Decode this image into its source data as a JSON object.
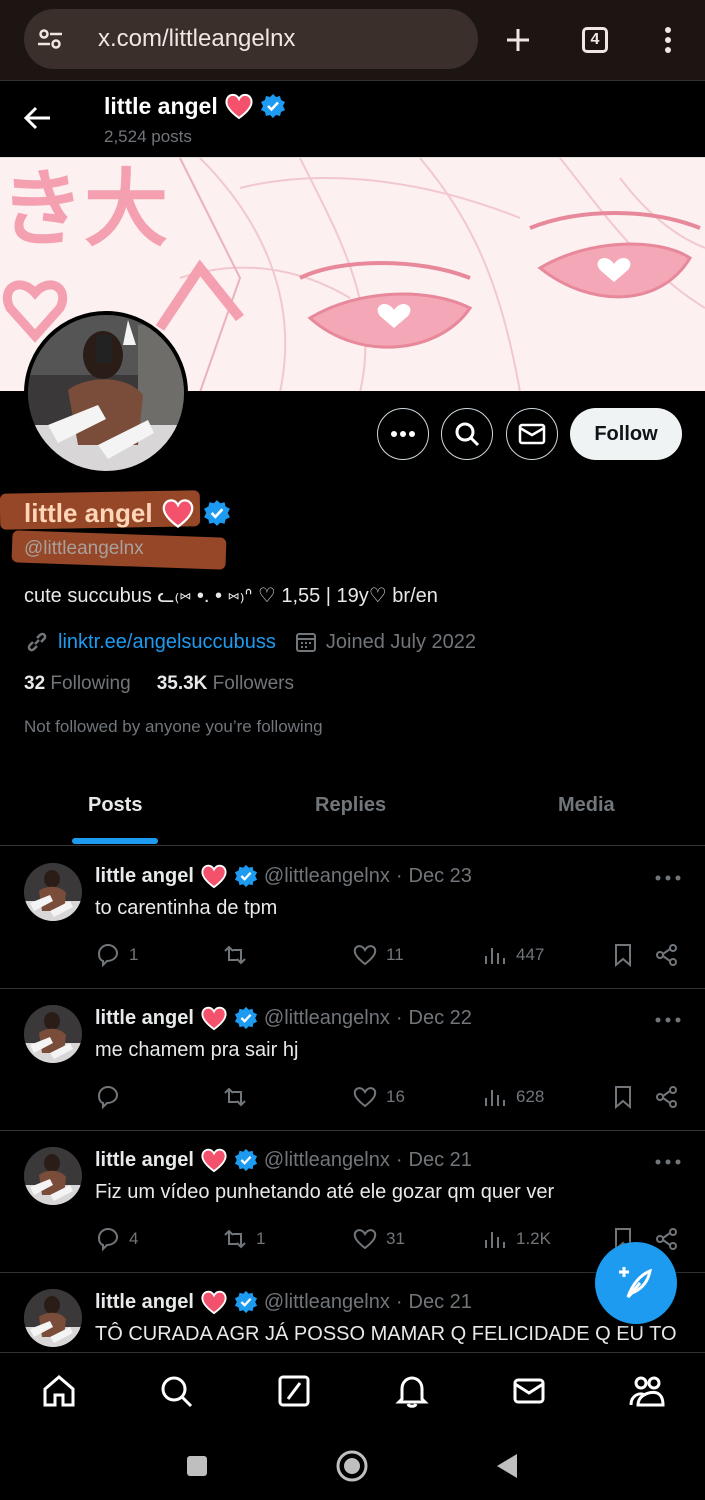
{
  "browser": {
    "url": "x.com/littleangelnx",
    "tab_count": "4",
    "icons": [
      "site-settings-icon",
      "new-tab-icon",
      "tab-switcher-icon",
      "kebab-menu-icon"
    ]
  },
  "header": {
    "name": "little angel",
    "posts_count": "2,524 posts"
  },
  "profile": {
    "name": "little angel",
    "handle": "@littleangelnx",
    "bio": "cute succubus ᓚ₍⑅ •. • ⑅₎ᐢ ♡ 1,55 | 19y♡ br/en",
    "link": "linktr.ee/angelsuccubuss",
    "joined": "Joined July 2022",
    "following_count": "32",
    "following_label": "Following",
    "followers_count": "35.3K",
    "followers_label": "Followers",
    "not_followed": "Not followed by anyone you’re following",
    "follow_label": "Follow",
    "banner_text": "き大"
  },
  "tabs": [
    {
      "label": "Posts",
      "active": true
    },
    {
      "label": "Replies",
      "active": false
    },
    {
      "label": "Media",
      "active": false
    }
  ],
  "posts": [
    {
      "name": "little angel",
      "handle": "@littleangelnx",
      "date": "Dec 23",
      "text": "to carentinha de tpm",
      "replies": "1",
      "reposts": "",
      "likes": "11",
      "views": "447"
    },
    {
      "name": "little angel",
      "handle": "@littleangelnx",
      "date": "Dec 22",
      "text": "me chamem pra sair hj",
      "replies": "",
      "reposts": "",
      "likes": "16",
      "views": "628"
    },
    {
      "name": "little angel",
      "handle": "@littleangelnx",
      "date": "Dec 21",
      "text": "Fiz um vídeo punhetando até ele gozar qm quer ver",
      "replies": "4",
      "reposts": "1",
      "likes": "31",
      "views": "1.2K"
    },
    {
      "name": "little angel",
      "handle": "@littleangelnx",
      "date": "Dec 21",
      "text": "TÔ CURADA AGR JÁ POSSO MAMAR Q FELICIDADE Q EU TO",
      "replies": "",
      "reposts": "",
      "likes": "",
      "views": ""
    }
  ],
  "colors": {
    "accent": "#1d9bf0",
    "background": "#000000",
    "heart": "#f4516c",
    "banner_pink": "#f4a7b6"
  }
}
